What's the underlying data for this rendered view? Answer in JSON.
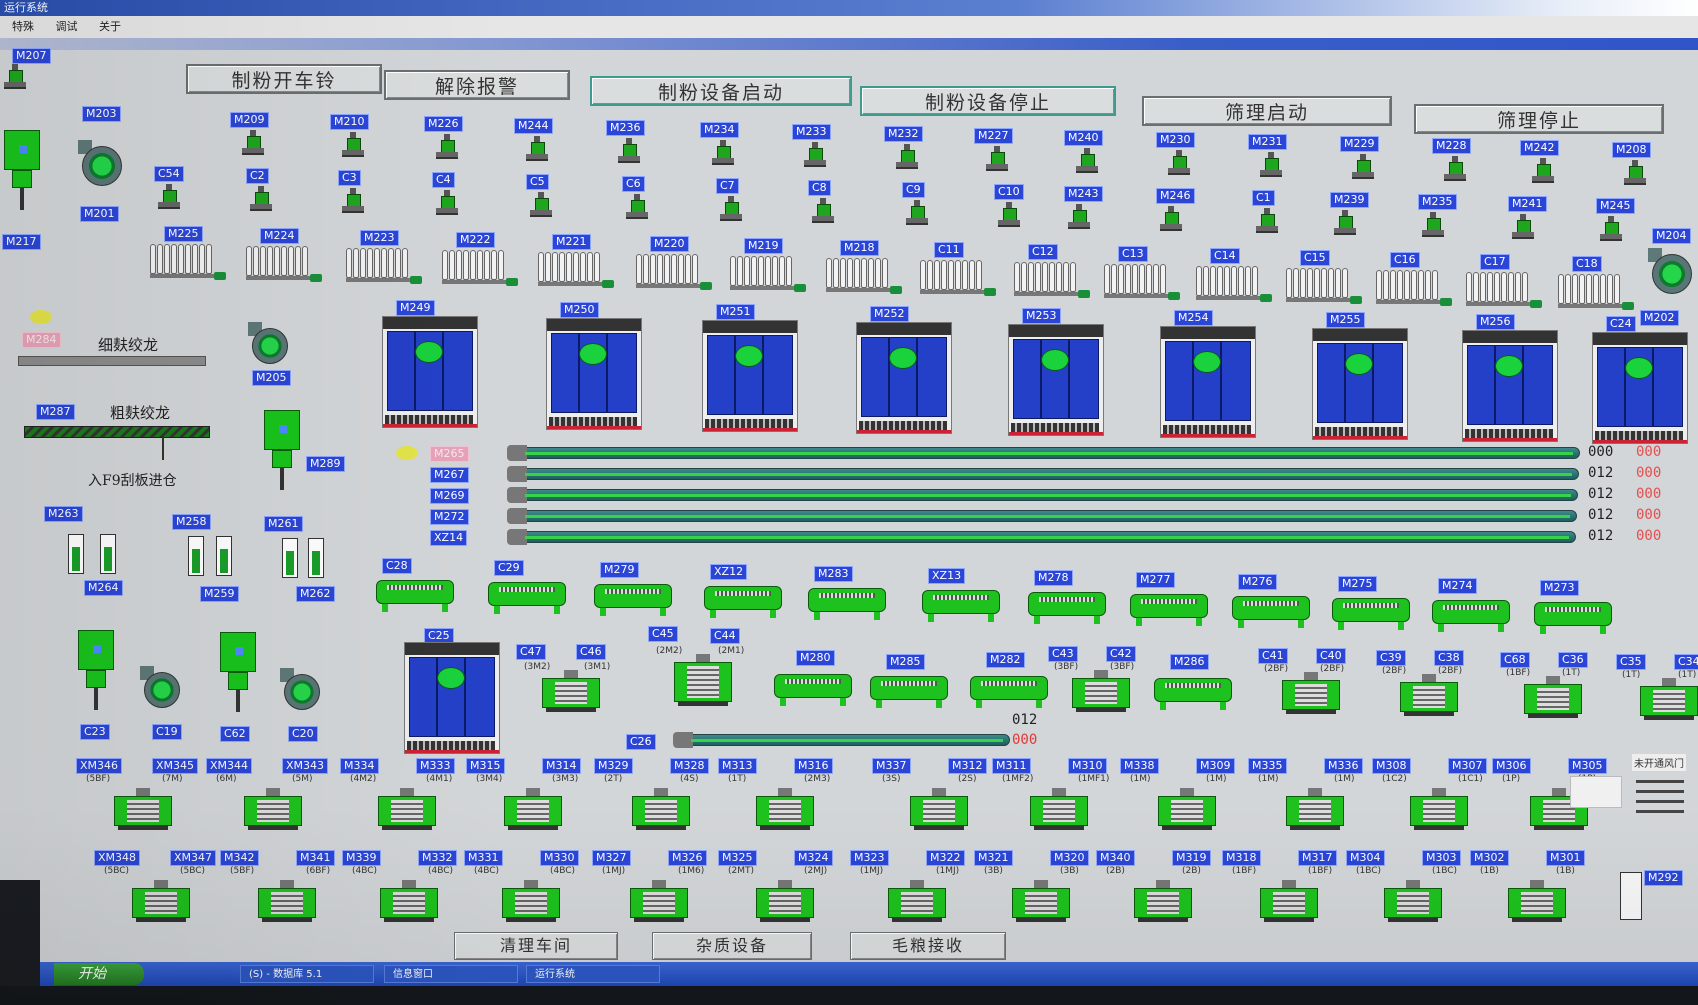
{
  "window": {
    "title": "运行系统"
  },
  "menu": [
    "特殊",
    "调试",
    "关于"
  ],
  "buttons": {
    "mill_bell": "制粉开车铃",
    "clear_alarm": "解除报警",
    "mill_start": "制粉设备启动",
    "mill_stop": "制粉设备停止",
    "sieve_start": "筛理启动",
    "sieve_stop": "筛理停止"
  },
  "left": {
    "fine_bran": "细麸绞龙",
    "coarse_bran": "粗麸绞龙",
    "to_f9": "入F9刮板进仓"
  },
  "row1": [
    "M209",
    "M210",
    "M226",
    "M244",
    "M236",
    "M234",
    "M233",
    "M232",
    "M227",
    "M240",
    "M230",
    "M231",
    "M229",
    "M228",
    "M242",
    "M208"
  ],
  "row2": [
    "C54",
    "C2",
    "C3",
    "C4",
    "C5",
    "C6",
    "C7",
    "C8",
    "C9",
    "C10",
    "M243",
    "M246",
    "C1",
    "M239",
    "M235",
    "M241",
    "M245"
  ],
  "row3": [
    "M225",
    "M224",
    "M223",
    "M222",
    "M221",
    "M220",
    "M219",
    "M218",
    "C11",
    "C12",
    "C13",
    "C14",
    "C15",
    "C16",
    "C17",
    "C18"
  ],
  "silos": [
    "M249",
    "M250",
    "M251",
    "M252",
    "M253",
    "M254",
    "M255",
    "M256",
    "C24"
  ],
  "conveyors": {
    "labels": [
      "M265",
      "M267",
      "M269",
      "M272",
      "XZ14"
    ],
    "values_a": [
      "000",
      "012",
      "012",
      "012",
      "012"
    ],
    "values_b": [
      "000",
      "000",
      "000",
      "000",
      "000"
    ]
  },
  "screws": [
    "C28",
    "C29",
    "M279",
    "XZ12",
    "M283",
    "XZ13",
    "M278",
    "M277",
    "M276",
    "M275",
    "M274",
    "M273"
  ],
  "mid": {
    "c25": "C25",
    "c45": "C45",
    "c44": "C44",
    "c47": "C47",
    "c46": "C46",
    "c47_sub": "(3M2)",
    "c46_sub": "(3M1)",
    "c45_sub": "(2M2)",
    "c44_sub": "(2M1)",
    "m280": "M280",
    "m285": "M285",
    "m282": "M282",
    "m286": "M286",
    "c26": "C26",
    "val_a": "012",
    "val_b": "000",
    "pairs": [
      {
        "a": "C43",
        "b": "C42",
        "sa": "(3BF)",
        "sb": "(3BF)"
      },
      {
        "a": "C41",
        "b": "C40",
        "sa": "(2BF)",
        "sb": "(2BF)"
      },
      {
        "a": "C39",
        "b": "C38",
        "sa": "(2BF)",
        "sb": "(2BF)"
      },
      {
        "a": "C68",
        "b": "C36",
        "sa": "(1BF)",
        "sb": "(1T)"
      },
      {
        "a": "C35",
        "b": "C34",
        "sa": "(1T)",
        "sb": "(1T)"
      }
    ]
  },
  "leftequip": {
    "m207": "M207",
    "m203": "M203",
    "m201": "M201",
    "m217": "M217",
    "m284": "M284",
    "m205": "M205",
    "m287": "M287",
    "m289": "M289",
    "m263": "M263",
    "m264": "M264",
    "m258": "M258",
    "m259": "M259",
    "m261": "M261",
    "m262": "M262",
    "c23": "C23",
    "c19": "C19",
    "c62": "C62",
    "c20": "C20",
    "m204": "M204",
    "m202": "M202"
  },
  "row7": [
    {
      "a": "XM346",
      "b": "XM345",
      "sa": "(5BF)",
      "sb": "(7M)"
    },
    {
      "a": "XM344",
      "b": "XM343",
      "sa": "(6M)",
      "sb": "(5M)"
    },
    {
      "a": "M334",
      "b": "M333",
      "sa": "(4M2)",
      "sb": "(4M1)"
    },
    {
      "a": "M315",
      "b": "M314",
      "sa": "(3M4)",
      "sb": "(3M3)"
    },
    {
      "a": "M329",
      "b": "M328",
      "sa": "(2T)",
      "sb": "(4S)"
    },
    {
      "a": "M313",
      "b": "M316",
      "sa": "(1T)",
      "sb": "(2M3)"
    },
    {
      "a": "M337",
      "b": "M312",
      "sa": "(3S)",
      "sb": "(2S)"
    },
    {
      "a": "M311",
      "b": "M310",
      "sa": "(1MF2)",
      "sb": "(1MF1)"
    },
    {
      "a": "M338",
      "b": "M309",
      "sa": "(1M)",
      "sb": "(1M)"
    },
    {
      "a": "M335",
      "b": "M336",
      "sa": "(1M)",
      "sb": "(1M)"
    },
    {
      "a": "M308",
      "b": "M307",
      "sa": "(1C2)",
      "sb": "(1C1)"
    },
    {
      "a": "M306",
      "b": "M305",
      "sa": "(1P)",
      "sb": "(1P)"
    }
  ],
  "row8": [
    {
      "a": "XM348",
      "b": "XM347",
      "sa": "(5BC)",
      "sb": "(5BC)"
    },
    {
      "a": "M342",
      "b": "M341",
      "sa": "(5BF)",
      "sb": "(6BF)"
    },
    {
      "a": "M339",
      "b": "M332",
      "sa": "(4BC)",
      "sb": "(4BC)"
    },
    {
      "a": "M331",
      "b": "M330",
      "sa": "(4BC)",
      "sb": "(4BC)"
    },
    {
      "a": "M327",
      "b": "M326",
      "sa": "(1MJ)",
      "sb": "(1M6)"
    },
    {
      "a": "M325",
      "b": "M324",
      "sa": "(2MT)",
      "sb": "(2MJ)"
    },
    {
      "a": "M323",
      "b": "M322",
      "sa": "(1MJ)",
      "sb": "(1MJ)"
    },
    {
      "a": "M321",
      "b": "M320",
      "sa": "(3B)",
      "sb": "(3B)"
    },
    {
      "a": "M340",
      "b": "M319",
      "sa": "(2B)",
      "sb": "(2B)"
    },
    {
      "a": "M318",
      "b": "M317",
      "sa": "(1BF)",
      "sb": "(1BF)"
    },
    {
      "a": "M304",
      "b": "M303",
      "sa": "(1BC)",
      "sb": "(1BC)"
    },
    {
      "a": "M302",
      "b": "M301",
      "sa": "(1B)",
      "sb": "(1B)"
    }
  ],
  "right": {
    "door": "未开通风门",
    "m292": "M292"
  },
  "tabs": [
    "清理车间",
    "杂质设备",
    "毛粮接收"
  ],
  "taskbar": {
    "start": "开始",
    "item1": "(S) - 数据库 5.1",
    "item2": "信息窗口",
    "item3": "运行系统"
  }
}
